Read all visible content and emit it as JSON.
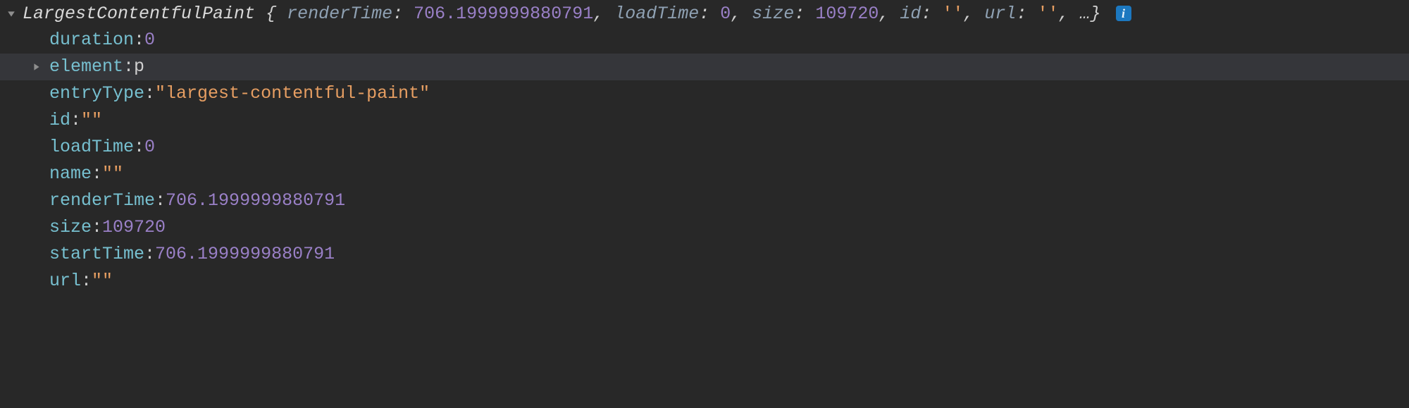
{
  "summary": {
    "className": "LargestContentfulPaint",
    "open": "{",
    "close": "}",
    "fields": [
      {
        "key": "renderTime",
        "valType": "num",
        "val": "706.1999999880791"
      },
      {
        "key": "loadTime",
        "valType": "num",
        "val": "0"
      },
      {
        "key": "size",
        "valType": "num",
        "val": "109720"
      },
      {
        "key": "id",
        "valType": "str",
        "val": "''"
      },
      {
        "key": "url",
        "valType": "str",
        "val": "''"
      }
    ],
    "ellipsis": "…",
    "infoGlyph": "i"
  },
  "props": {
    "duration": {
      "type": "num",
      "val": "0"
    },
    "element": {
      "type": "el",
      "val": "p"
    },
    "entryType": {
      "type": "str",
      "val": "\"largest-contentful-paint\""
    },
    "id": {
      "type": "str",
      "val": "\"\""
    },
    "loadTime": {
      "type": "num",
      "val": "0"
    },
    "name": {
      "type": "str",
      "val": "\"\""
    },
    "renderTime": {
      "type": "num",
      "val": "706.1999999880791"
    },
    "size": {
      "type": "num",
      "val": "109720"
    },
    "startTime": {
      "type": "num",
      "val": "706.1999999880791"
    },
    "url": {
      "type": "str",
      "val": "\"\""
    }
  },
  "labels": {
    "duration": "duration",
    "element": "element",
    "entryType": "entryType",
    "id": "id",
    "loadTime": "loadTime",
    "name": "name",
    "renderTime": "renderTime",
    "size": "size",
    "startTime": "startTime",
    "url": "url"
  }
}
